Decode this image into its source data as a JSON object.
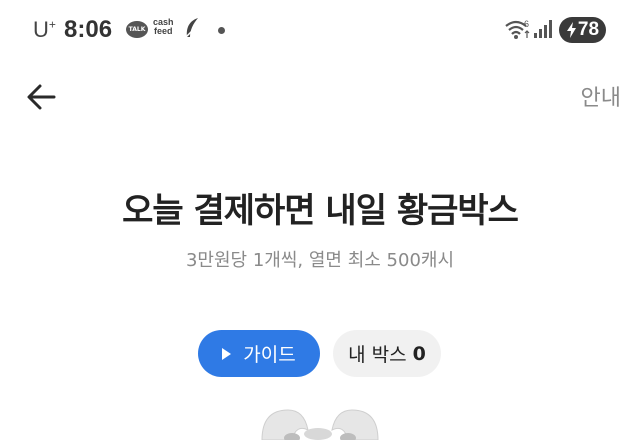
{
  "status_bar": {
    "carrier": "U",
    "carrier_sup": "+",
    "time": "8:06",
    "app_icons": [
      "talk-icon",
      "cashfeed-icon",
      "feather-icon",
      "dot-icon"
    ],
    "talk_label": "TALK",
    "cashfeed_line1": "cash",
    "cashfeed_line2": "feed",
    "wifi_badge": "6",
    "battery": "78"
  },
  "header": {
    "back_icon": "arrow-left-icon",
    "info_label": "안내"
  },
  "main": {
    "title": "오늘 결제하면 내일 황금박스",
    "subtitle": "3만원당 1개씩, 열면 최소 500캐시",
    "guide_button": "가이드",
    "my_box_label": "내 박스",
    "my_box_count": "0",
    "image": "earbuds-product-image"
  },
  "colors": {
    "accent": "#2f7ae5",
    "chip_bg": "#f1f1f1",
    "subtitle": "#8a8a8a"
  }
}
